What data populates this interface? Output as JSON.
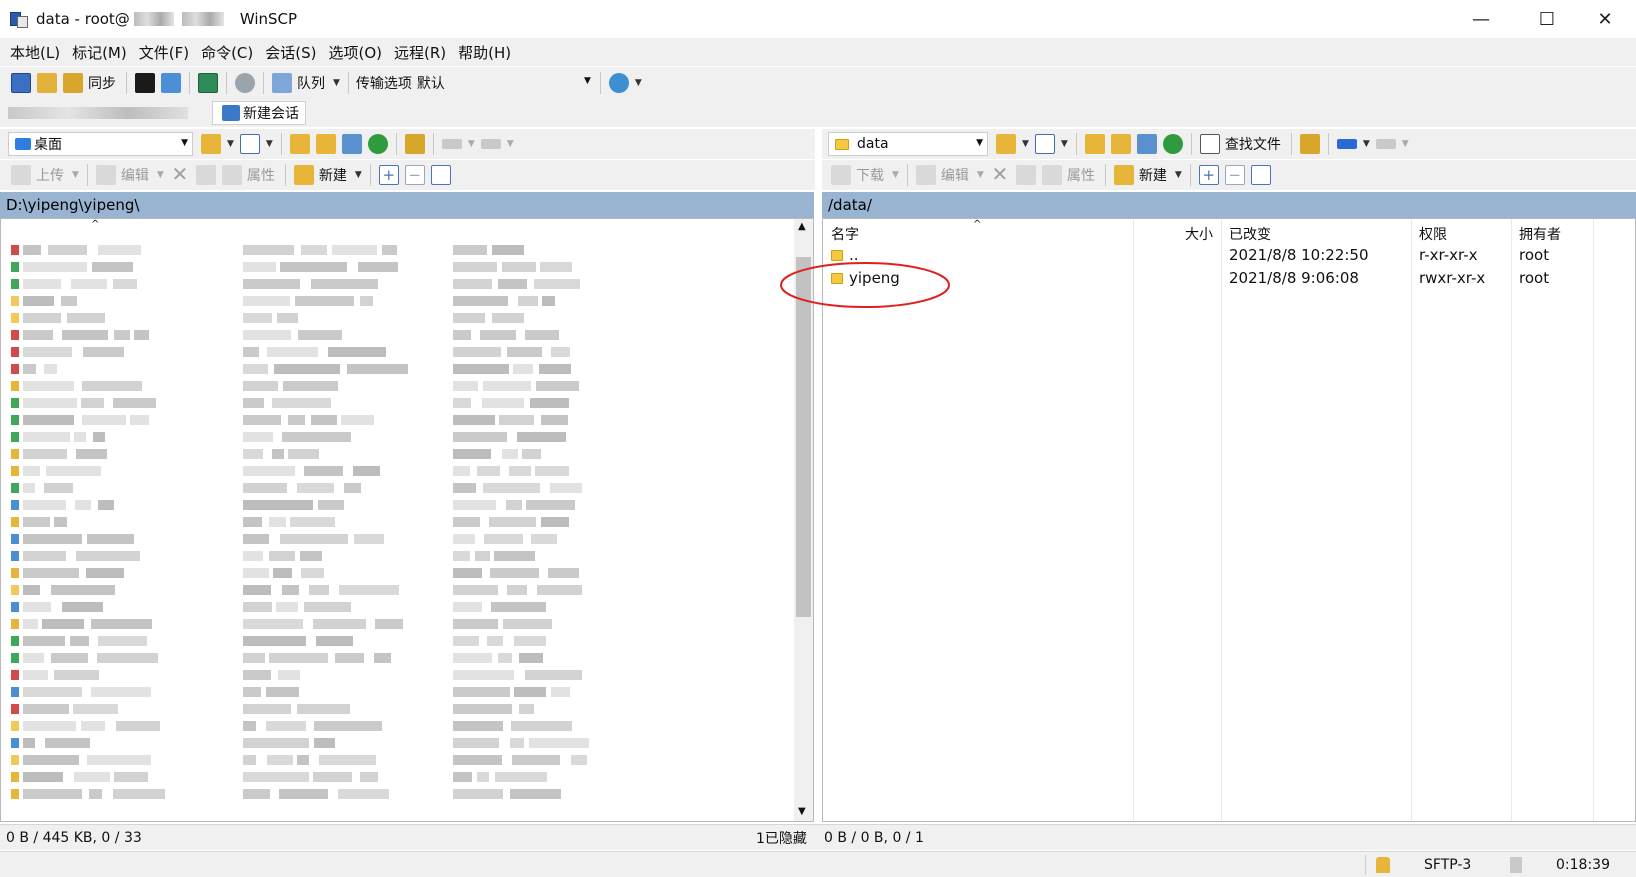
{
  "window": {
    "title_prefix": "data - root@",
    "app_name": "WinSCP",
    "minimize": "—",
    "maximize": "☐",
    "close": "✕"
  },
  "menu": [
    "本地(L)",
    "标记(M)",
    "文件(F)",
    "命令(C)",
    "会话(S)",
    "选项(O)",
    "远程(R)",
    "帮助(H)"
  ],
  "toolbar": {
    "sync_label": "同步",
    "queue_label": "队列",
    "transfer_options_label": "传输选项",
    "transfer_preset": "默认"
  },
  "session_tabs": {
    "new_session_label": "新建会话"
  },
  "left": {
    "location": "桌面",
    "upload_label": "上传",
    "edit_label": "编辑",
    "properties_label": "属性",
    "new_label": "新建",
    "path": "D:\\yipeng\\yipeng\\",
    "status_left": "0 B / 445 KB,  0 / 33",
    "status_hidden": "1已隐藏"
  },
  "right": {
    "location": "data",
    "find_files_label": "查找文件",
    "download_label": "下载",
    "edit_label": "编辑",
    "properties_label": "属性",
    "new_label": "新建",
    "path": "/data/",
    "columns": {
      "name": "名字",
      "size": "大小",
      "changed": "已改变",
      "rights": "权限",
      "owner": "拥有者"
    },
    "rows": [
      {
        "name": "..",
        "size": "",
        "changed": "2021/8/8 10:22:50",
        "rights": "r-xr-xr-x",
        "owner": "root"
      },
      {
        "name": "yipeng",
        "size": "",
        "changed": "2021/8/8 9:06:08",
        "rights": "rwxr-xr-x",
        "owner": "root"
      }
    ],
    "status": "0 B / 0 B,  0 / 1"
  },
  "bottom_status": {
    "protocol": "SFTP-3",
    "elapsed": "0:18:39"
  },
  "colors": {
    "pathbar": "#99b4d1",
    "annotation": "#e02020",
    "folder": "#f5c842"
  }
}
